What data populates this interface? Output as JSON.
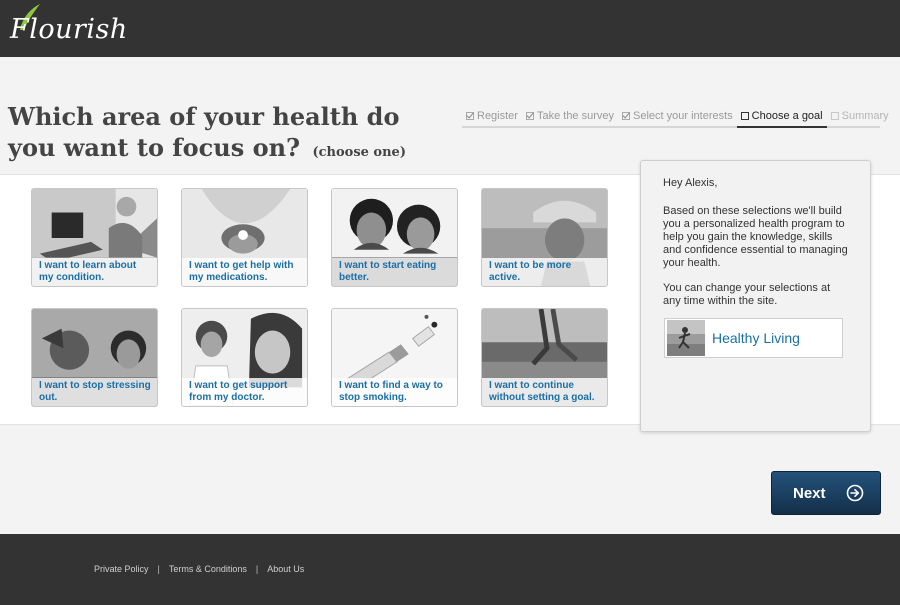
{
  "header": {
    "logo_text": "Flourish",
    "brand_color": "#8dc63f"
  },
  "page": {
    "title": "Which area of your health do you want to focus on?",
    "subtitle": "(choose one)"
  },
  "steps": [
    {
      "label": "Register",
      "state": "done"
    },
    {
      "label": "Take the survey",
      "state": "done"
    },
    {
      "label": "Select your interests",
      "state": "done"
    },
    {
      "label": "Choose a goal",
      "state": "current"
    },
    {
      "label": "Summary",
      "state": "upcoming"
    }
  ],
  "tiles": [
    {
      "caption": "I want to learn about my condition.",
      "icon": "laptop-woman-photo"
    },
    {
      "caption": "I want to get help with my medications.",
      "icon": "pill-on-tongue-photo"
    },
    {
      "caption": "I want to start eating better.",
      "icon": "couple-eating-watermelon-photo"
    },
    {
      "caption": "I want to be more active.",
      "icon": "man-bike-helmet-photo"
    },
    {
      "caption": "I want to stop stressing out.",
      "icon": "stressed-man-photo"
    },
    {
      "caption": "I want to get support from my doctor.",
      "icon": "doctor-and-woman-photo"
    },
    {
      "caption": "I want to find a way to stop smoking.",
      "icon": "broken-cigarette-photo"
    },
    {
      "caption": "I want to continue without setting a goal.",
      "icon": "walking-on-beach-photo"
    }
  ],
  "panel": {
    "greeting": "Hey Alexis,",
    "body": "Based on these selections we'll build you a personalized health program to help you gain the knowledge, skills and confidence essential to managing your health.",
    "note": "You can change your selections at any time within the site.",
    "selected_goal": "Healthy Living"
  },
  "next_button": {
    "label": "Next",
    "color": "#1d3f60"
  },
  "footer": {
    "links": [
      "Private Policy",
      "Terms & Conditions",
      "About Us"
    ]
  },
  "colors": {
    "link_blue": "#1b6fa6",
    "dark_bar": "#333333"
  }
}
